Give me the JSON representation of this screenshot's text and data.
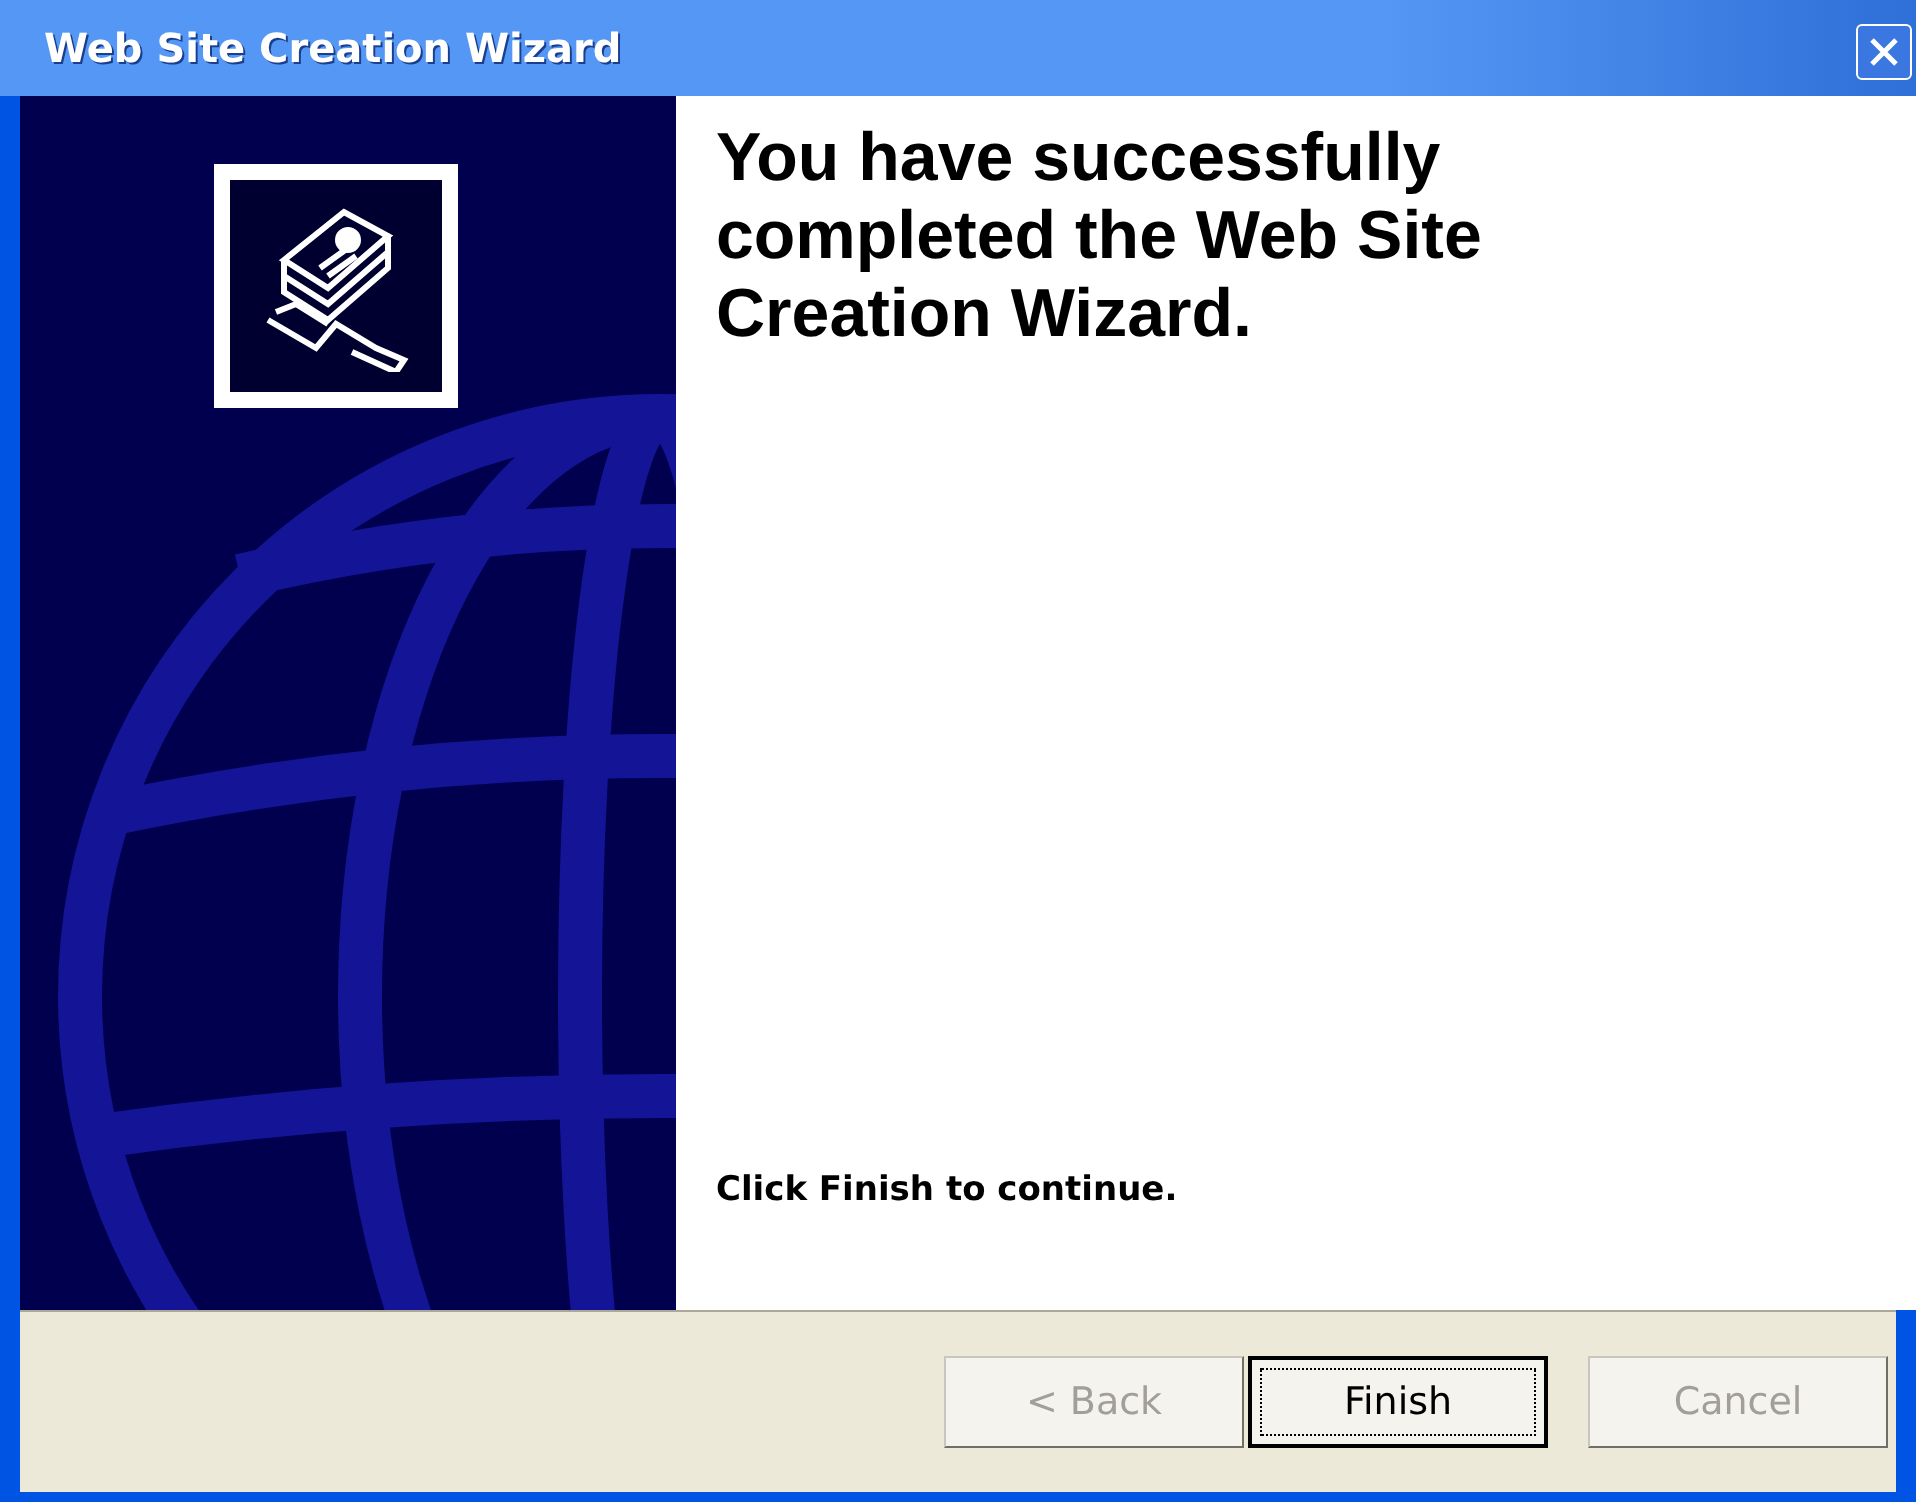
{
  "window": {
    "title": "Web Site Creation Wizard"
  },
  "heading": "You have successfully completed the Web Site Creation Wizard.",
  "instruction": "Click Finish to continue.",
  "buttons": [
    {
      "label": "< Back",
      "disabled": true,
      "default": false
    },
    {
      "label": "Finish",
      "disabled": false,
      "default": true
    },
    {
      "label": "Cancel",
      "disabled": true,
      "default": false
    }
  ]
}
